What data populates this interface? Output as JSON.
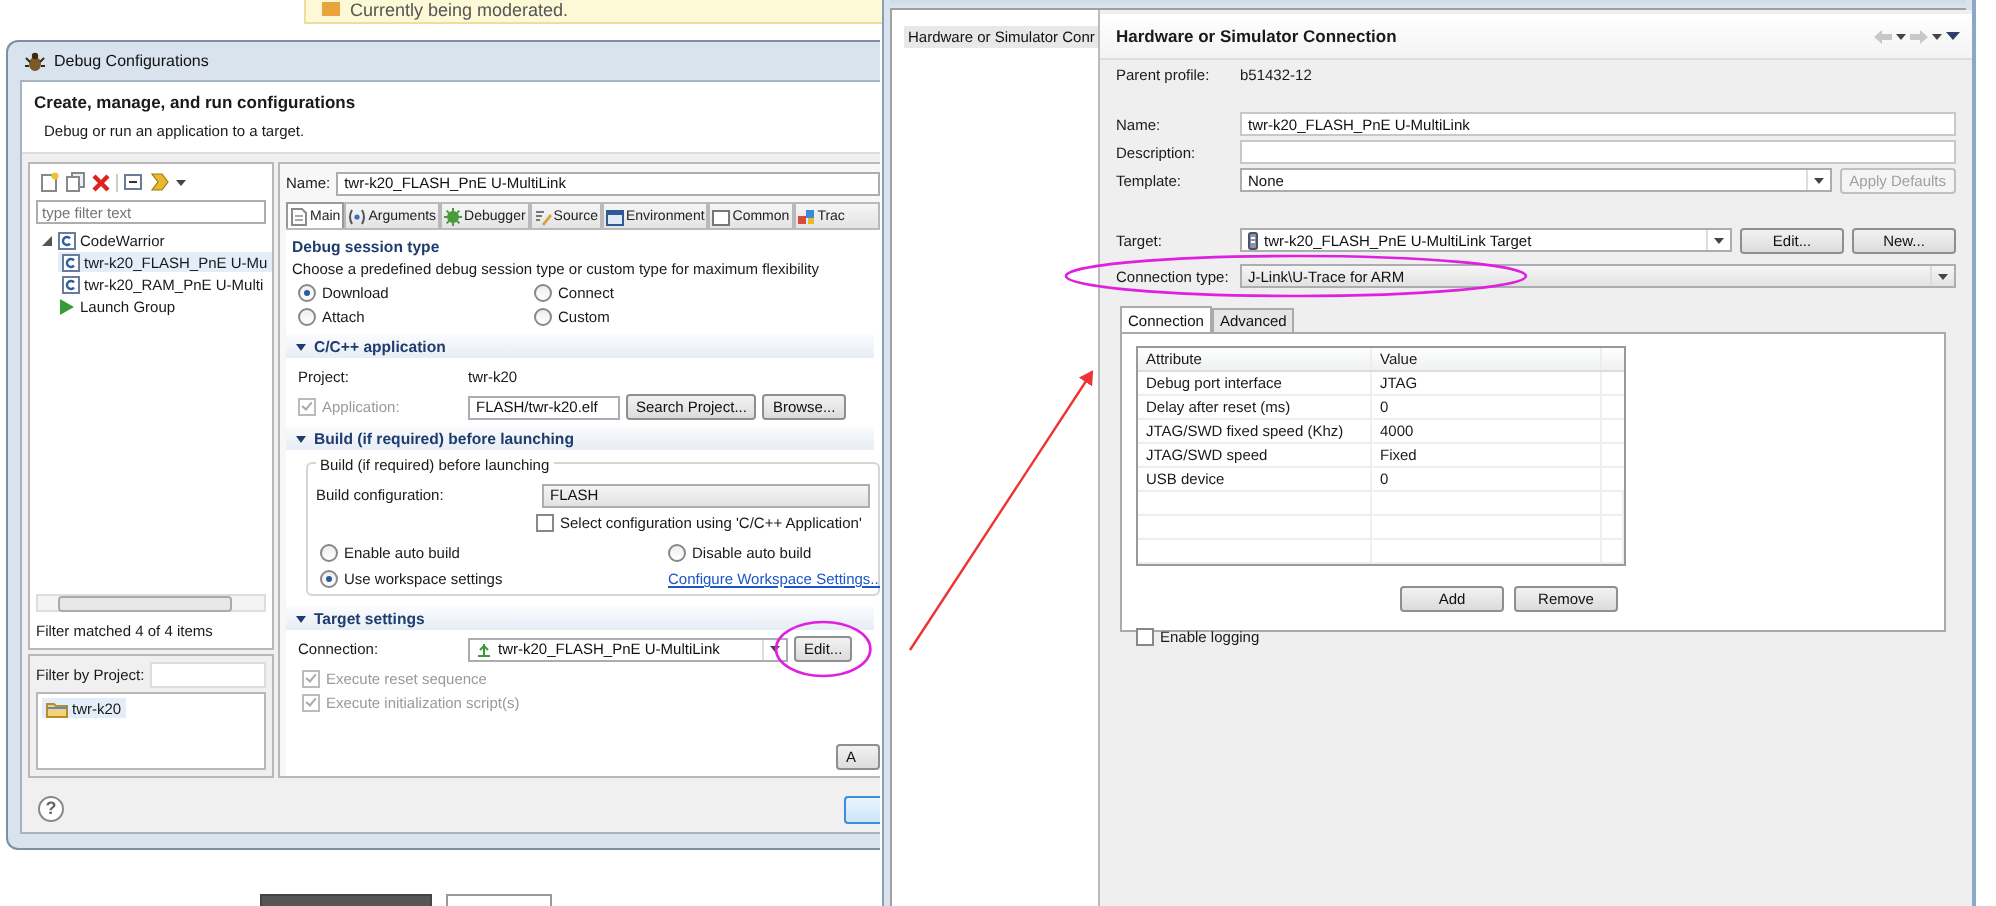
{
  "page": {
    "notice": "Currently being moderated."
  },
  "debug_dialog": {
    "title": "Debug Configurations",
    "heading": "Create, manage, and run configurations",
    "subheading": "Debug or run an application to a target.",
    "filter_placeholder": "type filter text",
    "tree": [
      {
        "label": "CodeWarrior",
        "kind": "group",
        "expanded": true,
        "selected": false,
        "children": [
          {
            "label": "twr-k20_FLASH_PnE U-Mu",
            "kind": "config",
            "selected": true
          },
          {
            "label": "twr-k20_RAM_PnE U-Multi",
            "kind": "config",
            "selected": false
          }
        ]
      },
      {
        "label": "Launch Group",
        "kind": "launch",
        "selected": false
      }
    ],
    "filter_status": "Filter matched 4 of 4 items",
    "project_filter_label": "Filter by Project:",
    "projects": [
      {
        "label": "twr-k20",
        "selected": true
      }
    ],
    "name_label": "Name:",
    "name_value": "twr-k20_FLASH_PnE U-MultiLink",
    "tabs": [
      {
        "label": "Main",
        "kind": "main",
        "selected": true
      },
      {
        "label": "Arguments",
        "kind": "arguments",
        "selected": false
      },
      {
        "label": "Debugger",
        "kind": "debugger",
        "selected": false
      },
      {
        "label": "Source",
        "kind": "source",
        "selected": false
      },
      {
        "label": "Environment",
        "kind": "environment",
        "selected": false
      },
      {
        "label": "Common",
        "kind": "common",
        "selected": false
      },
      {
        "label": "Trac",
        "kind": "trace",
        "selected": false
      }
    ],
    "session": {
      "heading": "Debug session type",
      "hint": "Choose a predefined debug session type or custom type for maximum flexibility",
      "options": [
        {
          "label": "Download",
          "selected": true
        },
        {
          "label": "Connect",
          "selected": false
        },
        {
          "label": "Attach",
          "selected": false
        },
        {
          "label": "Custom",
          "selected": false
        }
      ]
    },
    "application": {
      "heading": "C/C++ application",
      "expanded": true,
      "project_label": "Project:",
      "project_value": "twr-k20",
      "app_label": "Application:",
      "app_checked": true,
      "app_disabled": true,
      "app_value": "FLASH/twr-k20.elf",
      "buttons": [
        "Search Project...",
        "Browse..."
      ]
    },
    "build": {
      "heading": "Build (if required) before launching",
      "expanded": true,
      "group_title": "Build (if required) before launching",
      "config_label": "Build configuration:",
      "config_value": "FLASH",
      "select_checkbox": {
        "label": "Select configuration using 'C/C++ Application'",
        "checked": false
      },
      "options": [
        {
          "label": "Enable auto build",
          "selected": false
        },
        {
          "label": "Disable auto build",
          "selected": false
        },
        {
          "label": "Use workspace settings",
          "selected": true
        }
      ],
      "link": "Configure Workspace Settings..."
    },
    "target": {
      "heading": "Target settings",
      "expanded": true,
      "connection_label": "Connection:",
      "connection_value": "twr-k20_FLASH_PnE U-MultiLink",
      "edit_button": "Edit...",
      "checkboxes": [
        {
          "label": "Execute reset sequence",
          "checked": true,
          "disabled": true
        },
        {
          "label": "Execute initialization script(s)",
          "checked": true,
          "disabled": true
        }
      ]
    },
    "apply_button": "A",
    "help_button": "?"
  },
  "connection_dialog": {
    "nav_items": [
      {
        "label": "Hardware or Simulator Conr",
        "selected": true
      }
    ],
    "heading": "Hardware or Simulator Connection",
    "parent_profile": {
      "label": "Parent profile:",
      "value": "b51432-12"
    },
    "name": {
      "label": "Name:",
      "value": "twr-k20_FLASH_PnE U-MultiLink"
    },
    "description": {
      "label": "Description:"
    },
    "template": {
      "label": "Template:",
      "value": "None"
    },
    "apply_defaults": {
      "label": "Apply Defaults",
      "disabled": true
    },
    "target": {
      "label": "Target:",
      "value": "twr-k20_FLASH_PnE U-MultiLink Target",
      "buttons": [
        "Edit...",
        "New..."
      ]
    },
    "connection_type": {
      "label": "Connection type:",
      "value": "J-Link\\U-Trace for ARM"
    },
    "tabs": [
      {
        "label": "Connection",
        "selected": true
      },
      {
        "label": "Advanced",
        "selected": false
      }
    ],
    "table": {
      "columns": [
        "Attribute",
        "Value"
      ],
      "rows": [
        [
          "Debug port interface",
          "JTAG"
        ],
        [
          "Delay after reset (ms)",
          "0"
        ],
        [
          "JTAG/SWD fixed speed (Khz)",
          "4000"
        ],
        [
          "JTAG/SWD speed",
          "Fixed"
        ],
        [
          "USB device",
          "0"
        ]
      ]
    },
    "buttons": [
      "Add",
      "Remove"
    ],
    "logging": {
      "label": "Enable logging",
      "checked": false
    }
  }
}
